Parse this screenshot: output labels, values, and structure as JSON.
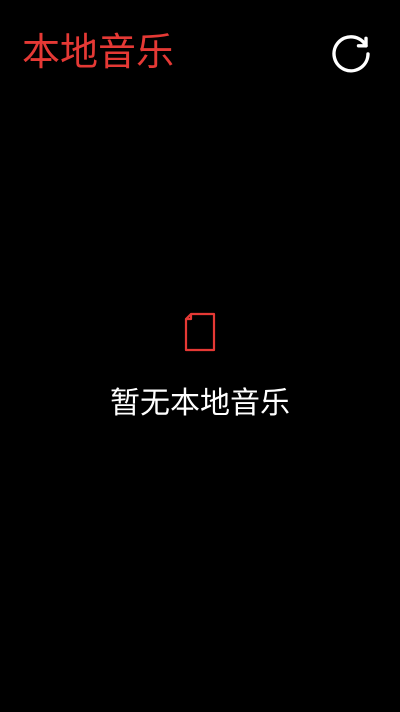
{
  "header": {
    "title": "本地音乐",
    "refresh_icon": "refresh-icon"
  },
  "empty_state": {
    "icon": "file-icon",
    "message": "暂无本地音乐"
  },
  "theme": {
    "background": "#000000",
    "accent": "#e53935",
    "text": "#ffffff"
  }
}
